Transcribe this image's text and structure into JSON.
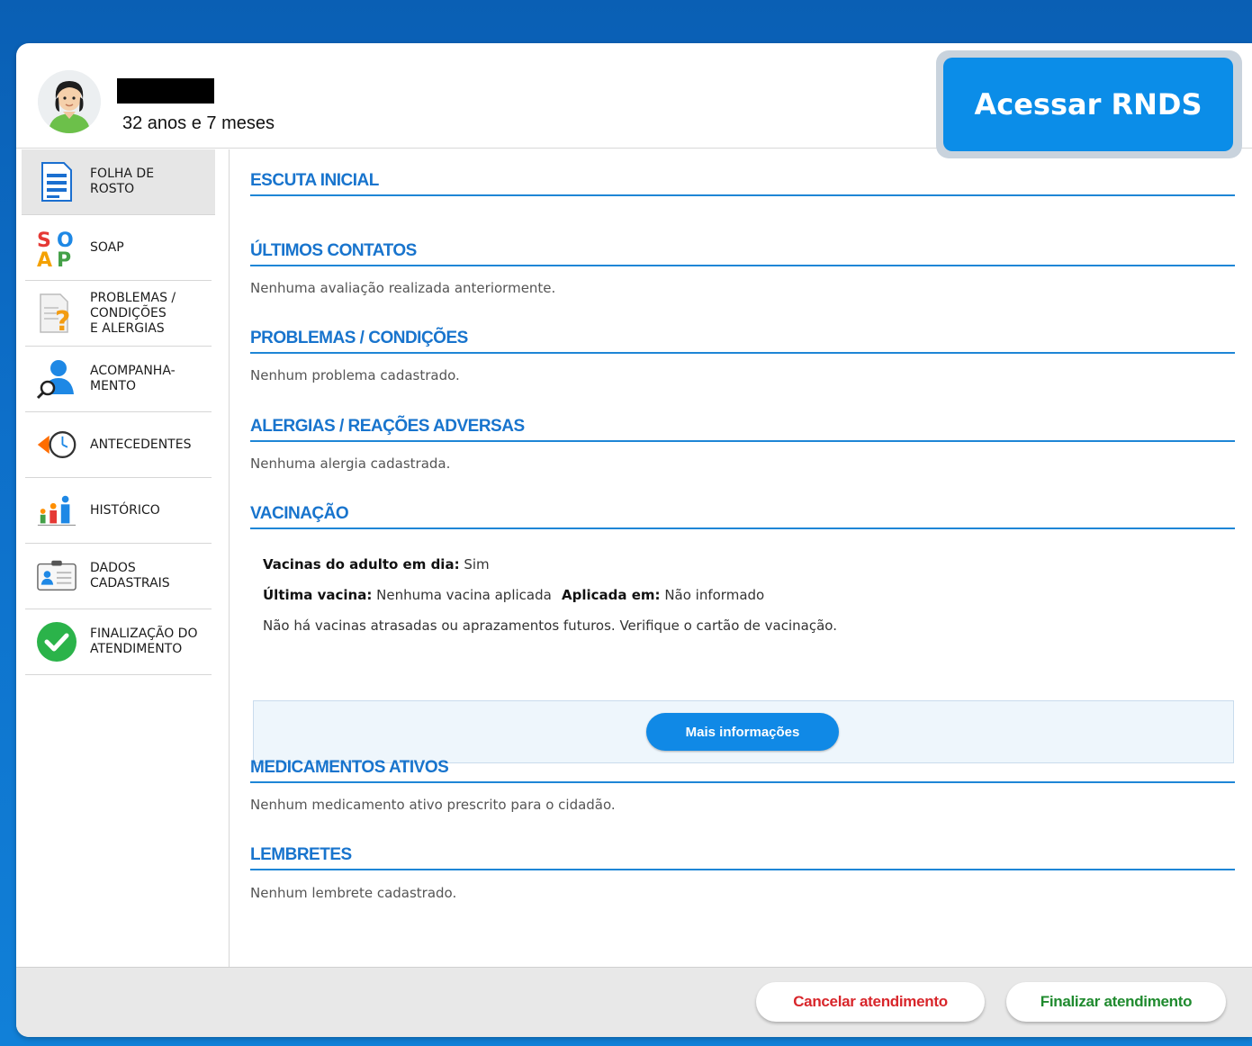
{
  "header": {
    "age": "32 anos e 7 meses",
    "rnds_button": "Acessar RNDS"
  },
  "sidebar": {
    "items": [
      {
        "label": "FOLHA DE\nROSTO",
        "icon": "document-icon"
      },
      {
        "label": "SOAP",
        "icon": "soap-icon"
      },
      {
        "label": "PROBLEMAS /\nCONDIÇÕES\nE ALERGIAS",
        "icon": "question-document-icon"
      },
      {
        "label": "ACOMPANHA-\nMENTO",
        "icon": "person-search-icon"
      },
      {
        "label": "ANTECEDENTES",
        "icon": "clock-back-icon"
      },
      {
        "label": "HISTÓRICO",
        "icon": "family-icon"
      },
      {
        "label": "DADOS\nCADASTRAIS",
        "icon": "id-card-icon"
      },
      {
        "label": "FINALIZAÇÃO DO\nATENDIMENTO",
        "icon": "check-circle-icon"
      }
    ]
  },
  "sections": {
    "escuta": {
      "title": "ESCUTA INICIAL"
    },
    "contatos": {
      "title": "ÚLTIMOS CONTATOS",
      "text": "Nenhuma avaliação realizada anteriormente."
    },
    "problemas": {
      "title": "PROBLEMAS / CONDIÇÕES",
      "text": "Nenhum problema cadastrado."
    },
    "alergias": {
      "title": "ALERGIAS / REAÇÕES ADVERSAS",
      "text": "Nenhuma alergia cadastrada."
    },
    "vacinacao": {
      "title": "VACINAÇÃO",
      "adulto_label": "Vacinas do adulto em dia:",
      "adulto_value": "Sim",
      "ultima_label": "Última vacina:",
      "ultima_value": "Nenhuma vacina aplicada",
      "aplicada_label": "Aplicada em:",
      "aplicada_value": "Não informado",
      "note": "Não há vacinas atrasadas ou aprazamentos futuros. Verifique o cartão de vacinação.",
      "more_button": "Mais informações"
    },
    "medicamentos": {
      "title": "MEDICAMENTOS ATIVOS",
      "text": "Nenhum medicamento ativo prescrito para o cidadão."
    },
    "lembretes": {
      "title": "LEMBRETES",
      "text": "Nenhum lembrete cadastrado."
    }
  },
  "footer": {
    "cancel": "Cancelar atendimento",
    "finish": "Finalizar atendimento"
  },
  "colors": {
    "accent": "#1874cd",
    "cancel": "#d8262b",
    "finish": "#1f8a2e"
  }
}
